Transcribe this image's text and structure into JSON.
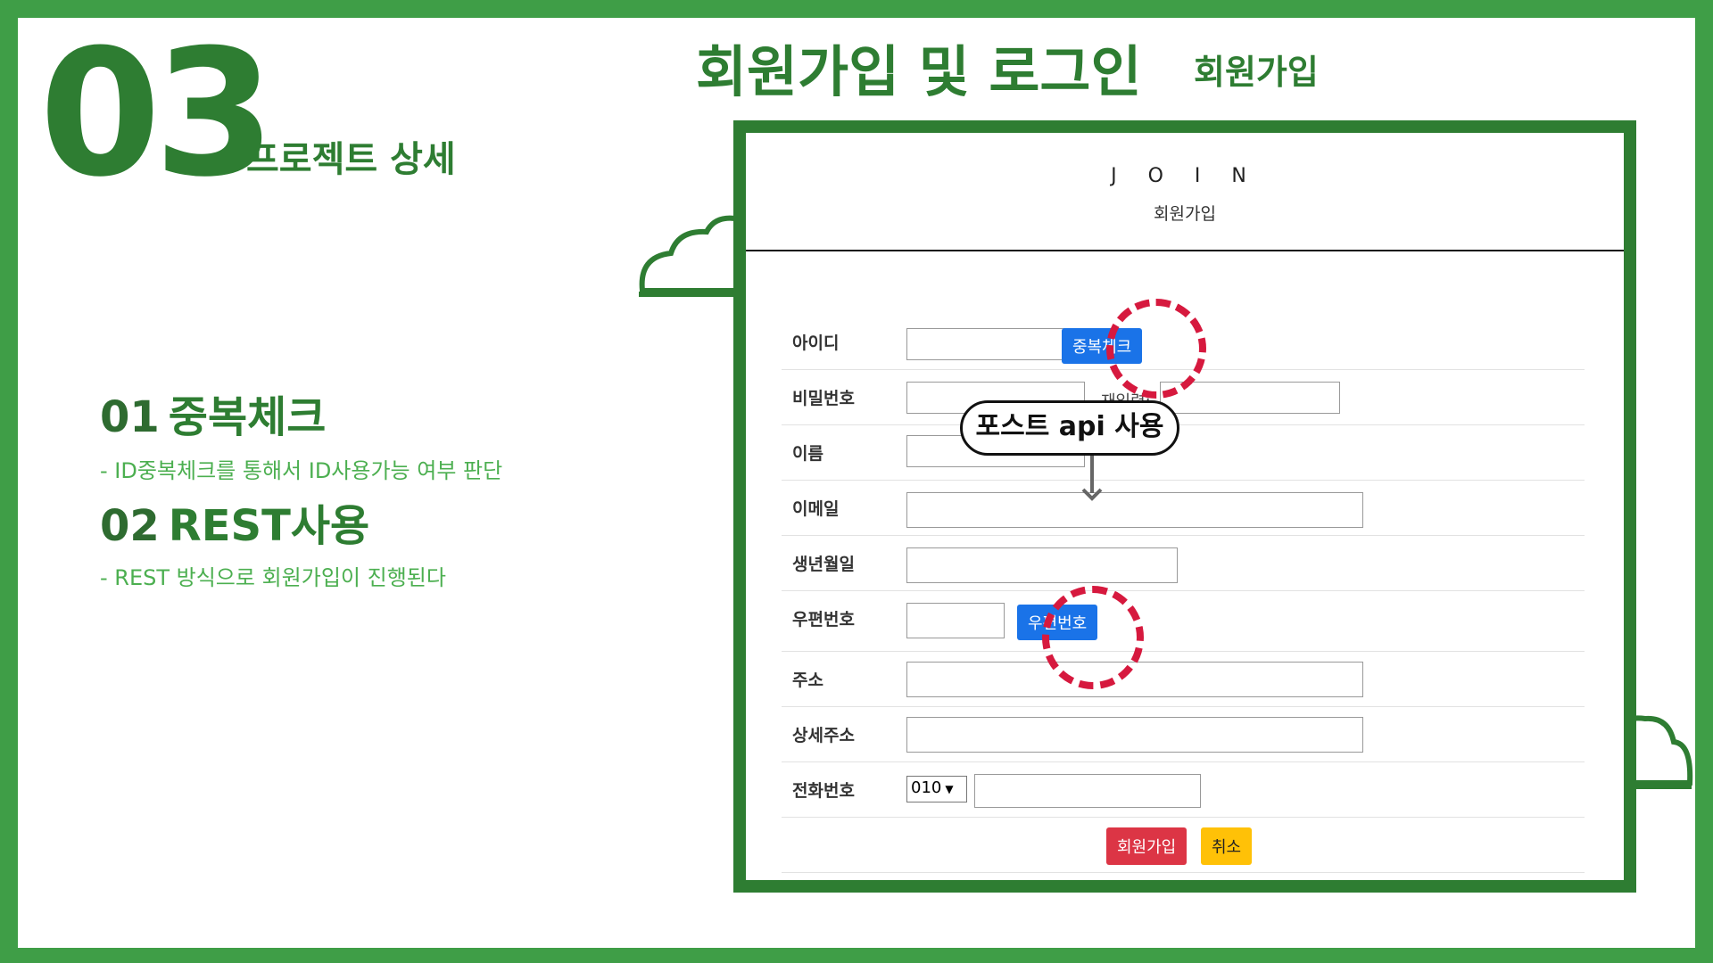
{
  "slide": {
    "number": "03",
    "section_title": "프로젝트 상세",
    "title": "회원가입 및 로그인",
    "subtitle": "회원가입"
  },
  "features": [
    {
      "num": "01",
      "title": "중복체크",
      "desc": "- ID중복체크를 통해서 ID사용가능 여부 판단"
    },
    {
      "num": "02",
      "title": "REST사용",
      "desc": "- REST 방식으로 회원가입이 진행된다"
    }
  ],
  "form": {
    "heading": "J O I N",
    "subheading": "회원가입",
    "labels": {
      "id": "아이디",
      "password": "비밀번호",
      "password_confirm": "재입력:",
      "name": "이름",
      "email": "이메일",
      "birth": "생년월일",
      "zipcode": "우편번호",
      "address": "주소",
      "address_detail": "상세주소",
      "phone": "전화번호"
    },
    "buttons": {
      "dup_check": "중복체크",
      "zipcode": "우편번호",
      "submit": "회원가입",
      "cancel": "취소"
    },
    "phone_prefix": "010"
  },
  "callout": "포스트 api 사용",
  "colors": {
    "frame_green": "#3f9e47",
    "title_green": "#2e7d32",
    "highlight_red": "#d6193e",
    "button_blue": "#1a73e8"
  }
}
